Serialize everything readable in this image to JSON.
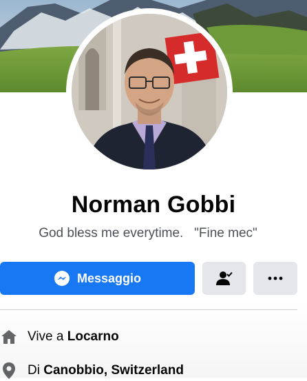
{
  "profile": {
    "name": "Norman Gobbi",
    "bio": "God bless me everytime.   \"Fine mec\""
  },
  "actions": {
    "message_label": "Messaggio",
    "message_icon": "messenger-icon",
    "friend_icon": "person-check-icon",
    "more_icon": "more-dots-icon"
  },
  "info": {
    "lives_prefix": "Vive a ",
    "lives_city": "Locarno",
    "from_prefix": "Di ",
    "from_place": "Canobbio, Switzerland"
  },
  "colors": {
    "primary": "#1877f2",
    "button_gray": "#e4e6eb",
    "text_primary": "#050505",
    "text_secondary": "#4b4f56"
  }
}
